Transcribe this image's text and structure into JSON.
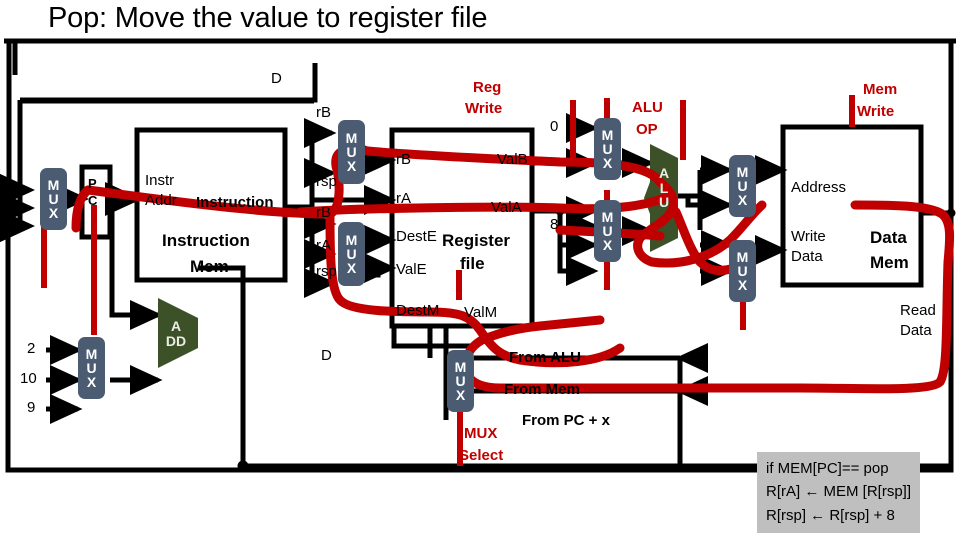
{
  "title": "Pop: Move the value to register file",
  "colors": {
    "highlight": "#C00000",
    "wire": "#000000",
    "mux_fill": "#4A5B72",
    "alu_fill": "#3D5128",
    "code_bg": "#BFBFBF"
  },
  "units": {
    "pc": "P\nC",
    "instruction_mem_port_a": "Instr",
    "instruction_mem_port_b": "Addr",
    "instruction_mem_out": "Instruction",
    "instruction_mem_name_l1": "Instruction",
    "instruction_mem_name_l2": "Mem",
    "adder": {
      "l1": "A",
      "l2": "DD"
    },
    "alu": "ALU",
    "register_file_l1": "Register",
    "register_file_l2": "file",
    "data_mem_l1": "Data",
    "data_mem_l2": "Mem",
    "mux_label": "MUX"
  },
  "control_signals": [
    {
      "name": "reg-write",
      "l1": "Reg",
      "l2": "Write"
    },
    {
      "name": "alu-op",
      "l1": "ALU",
      "l2": "OP"
    },
    {
      "name": "mem-write",
      "l1": "Mem",
      "l2": "Write"
    },
    {
      "name": "mux-select",
      "l1": "MUX",
      "l2": "Select"
    }
  ],
  "bus_labels": {
    "d_top": "D",
    "d_mid": "D"
  },
  "regfile_inputs": [
    "rB",
    "rsp",
    "rB",
    "rA",
    "rsp"
  ],
  "regfile_ports_left": [
    "rB",
    "rA",
    "DestE",
    "ValE",
    "DestM"
  ],
  "regfile_ports_right": [
    "ValB",
    "ValA",
    "ValM"
  ],
  "constants": {
    "alu_mux_zero": "0",
    "alu_mux_eight": "8",
    "pc_mux_2": "2",
    "pc_mux_10": "10",
    "pc_mux_9": "9"
  },
  "data_mem_ports": {
    "address": "Address",
    "write_data_l1": "Write",
    "write_data_l2": "Data",
    "read_data_l1": "Read",
    "read_data_l2": "Data"
  },
  "mux_sources": [
    "From ALU",
    "From Mem",
    "From PC + x"
  ],
  "code_box": {
    "line1": "if MEM[PC]== pop",
    "line2": "R[rA] ← MEM [R[rsp]]",
    "line3": "R[rsp] ← R[rsp] + 8"
  }
}
